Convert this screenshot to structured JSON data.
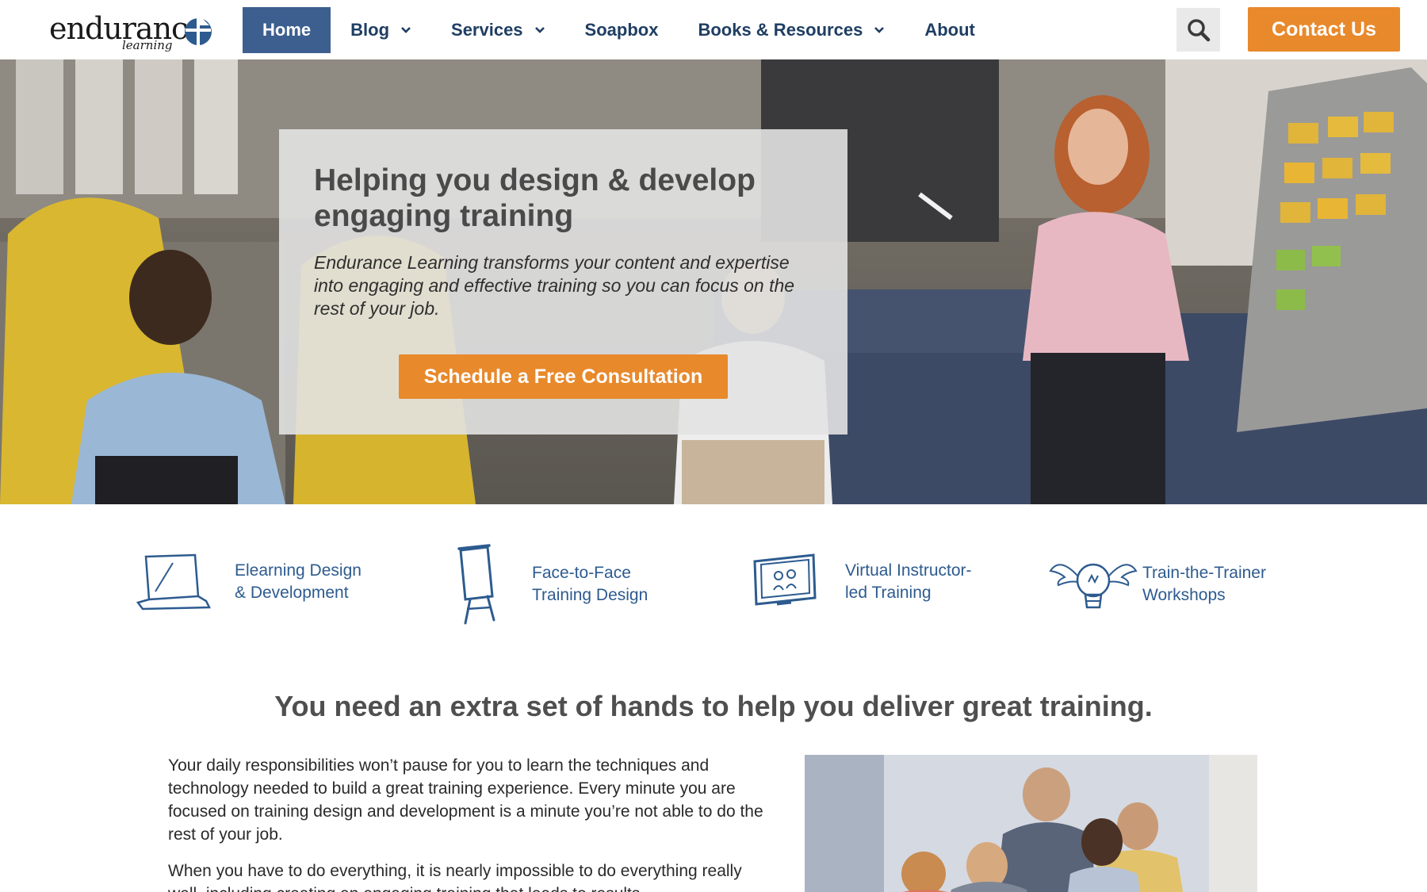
{
  "header": {
    "logo": {
      "wordmark": "endurance",
      "tagline": "learning"
    },
    "nav": [
      {
        "label": "Home",
        "active": true,
        "dropdown": false,
        "icon": null
      },
      {
        "label": "Blog",
        "active": false,
        "dropdown": true,
        "icon": "chevron-down-icon"
      },
      {
        "label": "Services",
        "active": false,
        "dropdown": true,
        "icon": "chevron-down-icon"
      },
      {
        "label": "Soapbox",
        "active": false,
        "dropdown": false,
        "icon": null
      },
      {
        "label": "Books & Resources",
        "active": false,
        "dropdown": true,
        "icon": "chevron-down-icon"
      },
      {
        "label": "About",
        "active": false,
        "dropdown": false,
        "icon": null
      }
    ],
    "search_icon": "search-icon",
    "contact_label": "Contact Us"
  },
  "hero": {
    "title": "Helping you design & develop engaging training",
    "subtitle": "Endurance Learning transforms your content and expertise into engaging and effective training so you can focus on the rest of your job.",
    "cta_label": "Schedule a Free Consultation"
  },
  "services": [
    {
      "icon": "laptop-icon",
      "label_lines": [
        "Elearning Design",
        "& Development"
      ]
    },
    {
      "icon": "easel-icon",
      "label_lines": [
        "Face-to-Face",
        "Training Design"
      ]
    },
    {
      "icon": "monitor-icon",
      "label_lines": [
        "Virtual Instructor-",
        "led Training"
      ]
    },
    {
      "icon": "lightbulb-wings-icon",
      "label_lines": [
        "Train-the-Trainer",
        "Workshops"
      ]
    }
  ],
  "content": {
    "heading": "You need an extra set of hands to help you deliver great training.",
    "paragraphs": [
      "Your daily responsibilities won’t pause for you to learn the techniques and technology needed to build a great training experience. Every minute you are focused on training design and development is a minute you’re not able to do the rest of your job.",
      "When you have to do everything, it is nearly impossible to do everything really well, including creating an engaging training that leads to results."
    ]
  },
  "colors": {
    "brand_blue": "#3d5f8f",
    "nav_text": "#1f3e63",
    "accent_orange": "#e8892b",
    "service_blue": "#2d5b8f"
  }
}
